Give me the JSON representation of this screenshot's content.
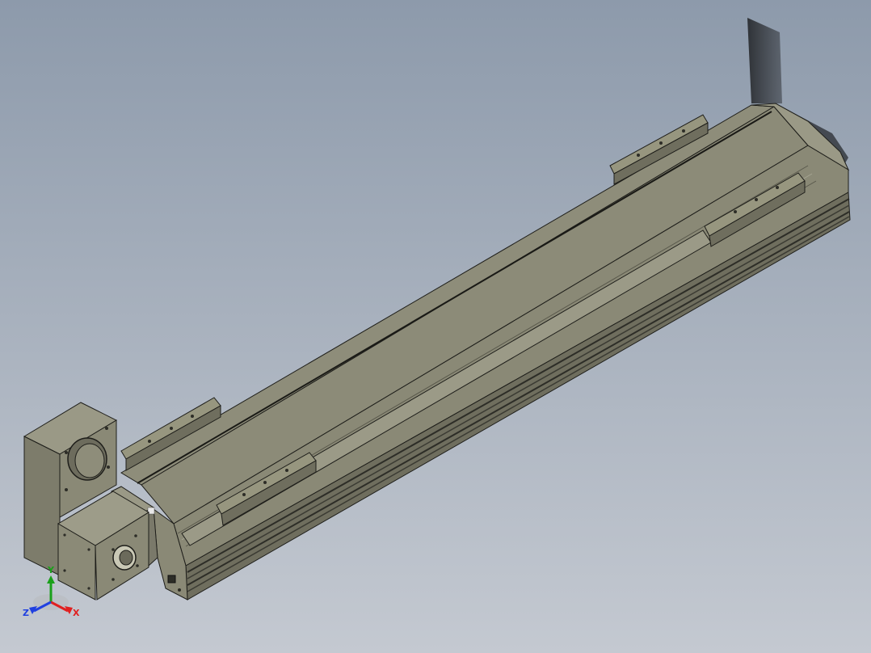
{
  "viewport": {
    "background_top": "#8d9aab",
    "background_bottom": "#c4c9d1"
  },
  "model": {
    "body_color": "#8b8a76",
    "top_face_color": "#8f8e7b",
    "side_face_color": "#6f6e5e",
    "dark_edge_color": "#1e1e1a",
    "slot_color": "#3b3b33"
  },
  "triad": {
    "x_label": "X",
    "y_label": "Y",
    "z_label": "Z",
    "x_color": "#e02020",
    "y_color": "#1aa01a",
    "z_color": "#2040e0"
  }
}
